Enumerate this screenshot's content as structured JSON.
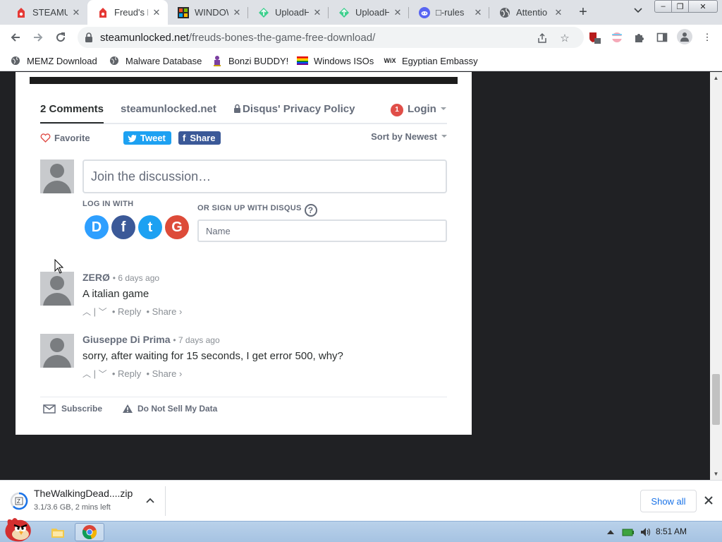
{
  "browser": {
    "tabs": [
      {
        "title": "STEAMU",
        "icon": "steam-unlocked-icon",
        "active": false
      },
      {
        "title": "Freud's B",
        "icon": "steam-unlocked-icon",
        "active": true
      },
      {
        "title": "WINDOW",
        "icon": "windows-icon",
        "active": false
      },
      {
        "title": "UploadH",
        "icon": "uploadhaven-icon",
        "active": false
      },
      {
        "title": "UploadH",
        "icon": "uploadhaven-icon",
        "active": false
      },
      {
        "title": "□-rules",
        "icon": "discord-icon",
        "active": false
      },
      {
        "title": "Attentio",
        "icon": "globe-icon",
        "active": false
      }
    ],
    "url_host": "steamunlocked.net",
    "url_path": "/freuds-bones-the-game-free-download/",
    "extension_badge": "3",
    "bookmarks": [
      {
        "label": "MEMZ Download",
        "icon": "globe-icon"
      },
      {
        "label": "Malware Database",
        "icon": "globe-icon"
      },
      {
        "label": "Bonzi BUDDY!",
        "icon": "bonzi-icon"
      },
      {
        "label": "Windows ISOs",
        "icon": "rainbow-flag-icon"
      },
      {
        "label": "Egyptian Embassy",
        "icon": "wix-icon"
      }
    ],
    "wix_text": "WiX"
  },
  "disqus": {
    "tabs": {
      "comments": "2 Comments",
      "site": "steamunlocked.net",
      "privacy": "Disqus' Privacy Policy",
      "login": "Login",
      "login_badge": "1"
    },
    "favorite": "Favorite",
    "tweet": "Tweet",
    "share": "Share",
    "sort": "Sort by Newest",
    "compose_placeholder": "Join the discussion…",
    "log_in_with": "LOG IN WITH",
    "sign_up": "OR SIGN UP WITH DISQUS",
    "help": "?",
    "sso": {
      "disqus": "D",
      "facebook": "f",
      "twitter": "t",
      "google": "G"
    },
    "name_placeholder": "Name",
    "comments": [
      {
        "author": "ZERØ",
        "time": "6 days ago",
        "text": "A italian game",
        "reply": "Reply",
        "share": "Share ›"
      },
      {
        "author": "Giuseppe Di Prima",
        "time": "7 days ago",
        "text": "sorry, after waiting for 15 seconds, I get error 500, why?",
        "reply": "Reply",
        "share": "Share ›"
      }
    ],
    "subscribe": "Subscribe",
    "do_not_sell": "Do Not Sell My Data"
  },
  "download": {
    "file_name": "TheWalkingDead....zip",
    "status": "3.1/3.6 GB, 2 mins left",
    "show_all": "Show all"
  },
  "taskbar": {
    "time": "8:51 AM"
  },
  "colors": {
    "twitter": "#1da1f2",
    "facebook": "#3b5998",
    "google": "#dd4b39",
    "disqus": "#2e9fff",
    "badge": "#e04e48"
  }
}
